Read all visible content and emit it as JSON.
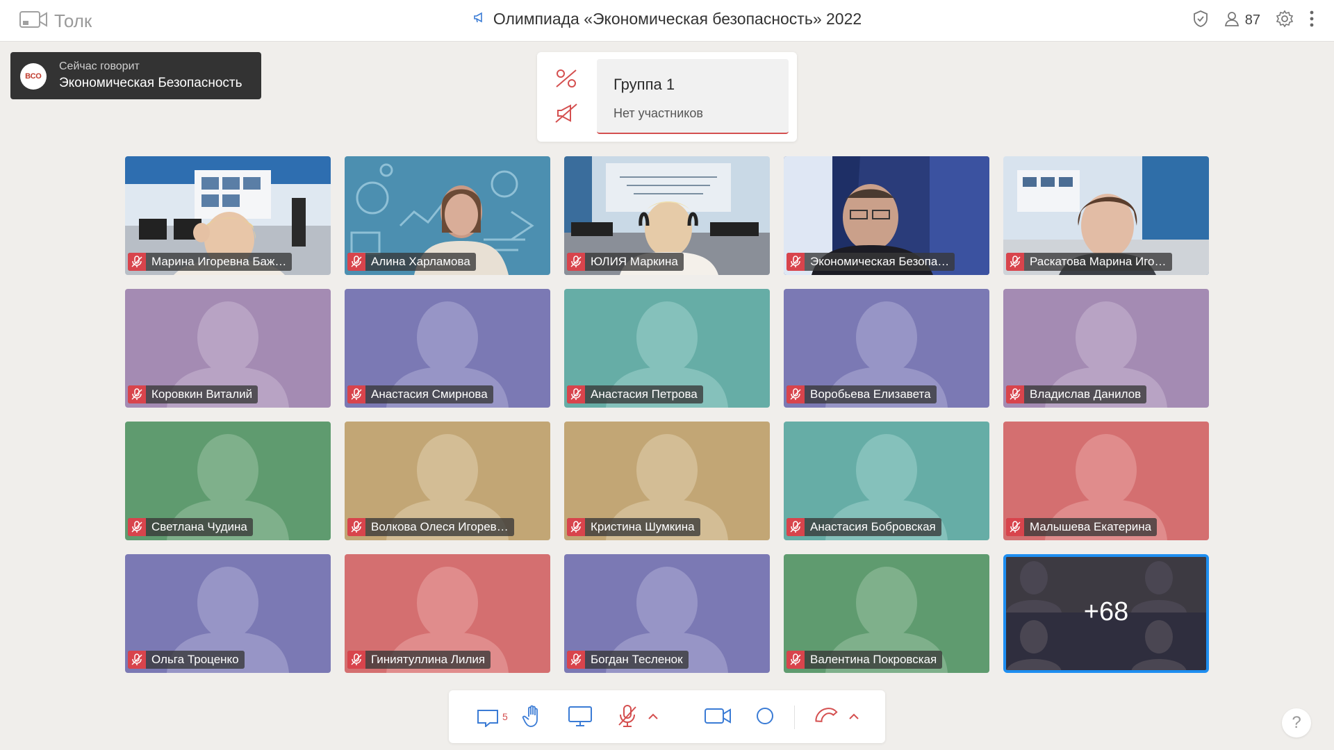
{
  "app": {
    "brand": "Толк"
  },
  "header": {
    "title": "Олимпиада «Экономическая безопасность» 2022",
    "participants_count": "87"
  },
  "speaking": {
    "label": "Сейчас говорит",
    "name": "Экономическая Безопасность",
    "logo_text": "ВСО"
  },
  "group_panel": {
    "name": "Группа 1",
    "status": "Нет участников"
  },
  "tiles": [
    {
      "name": "Марина Игоревна Баж…",
      "type": "video",
      "scene": "classroom"
    },
    {
      "name": "Алина Харламова",
      "type": "video",
      "scene": "pattern"
    },
    {
      "name": "ЮЛИЯ Маркина",
      "type": "video",
      "scene": "classroom2"
    },
    {
      "name": "Экономическая Безопа…",
      "type": "video",
      "scene": "curtain"
    },
    {
      "name": "Раскатова Марина Иго…",
      "type": "video",
      "scene": "classroom3"
    },
    {
      "name": "Коровкин Виталий",
      "type": "avatar",
      "bg": "#a48bb3",
      "fg": "#b8a3c4"
    },
    {
      "name": "Анастасия Смирнова",
      "type": "avatar",
      "bg": "#7b79b4",
      "fg": "#9795c6"
    },
    {
      "name": "Анастасия Петрова",
      "type": "avatar",
      "bg": "#66ada6",
      "fg": "#85c1bb"
    },
    {
      "name": "Воробьева Елизавета",
      "type": "avatar",
      "bg": "#7b79b4",
      "fg": "#9795c6"
    },
    {
      "name": "Владислав Данилов",
      "type": "avatar",
      "bg": "#a48bb3",
      "fg": "#b8a3c4"
    },
    {
      "name": "Светлана Чудина",
      "type": "avatar",
      "bg": "#5f9b6f",
      "fg": "#7fb08b"
    },
    {
      "name": "Волкова Олеся Игорев…",
      "type": "avatar",
      "bg": "#c2a675",
      "fg": "#d3bd95"
    },
    {
      "name": "Кристина Шумкина",
      "type": "avatar",
      "bg": "#c2a675",
      "fg": "#d3bd95"
    },
    {
      "name": "Анастасия Бобровская",
      "type": "avatar",
      "bg": "#66ada6",
      "fg": "#85c1bb"
    },
    {
      "name": "Малышева Екатерина",
      "type": "avatar",
      "bg": "#d46f70",
      "fg": "#e08c8c"
    },
    {
      "name": "Ольга Троценко",
      "type": "avatar",
      "bg": "#7b79b4",
      "fg": "#9795c6"
    },
    {
      "name": "Гиниятуллина Лилия",
      "type": "avatar",
      "bg": "#d46f70",
      "fg": "#e08c8c"
    },
    {
      "name": "Богдан Тесленок",
      "type": "avatar",
      "bg": "#7b79b4",
      "fg": "#9795c6"
    },
    {
      "name": "Валентина Покровская",
      "type": "avatar",
      "bg": "#5f9b6f",
      "fg": "#7fb08b"
    },
    {
      "name": "",
      "type": "more",
      "more": "+68"
    }
  ],
  "toolbar": {
    "chat_badge": "5"
  },
  "help": {
    "label": "?"
  },
  "colors": {
    "accent_red": "#d8444c",
    "highlight_blue": "#1e8ef0"
  }
}
